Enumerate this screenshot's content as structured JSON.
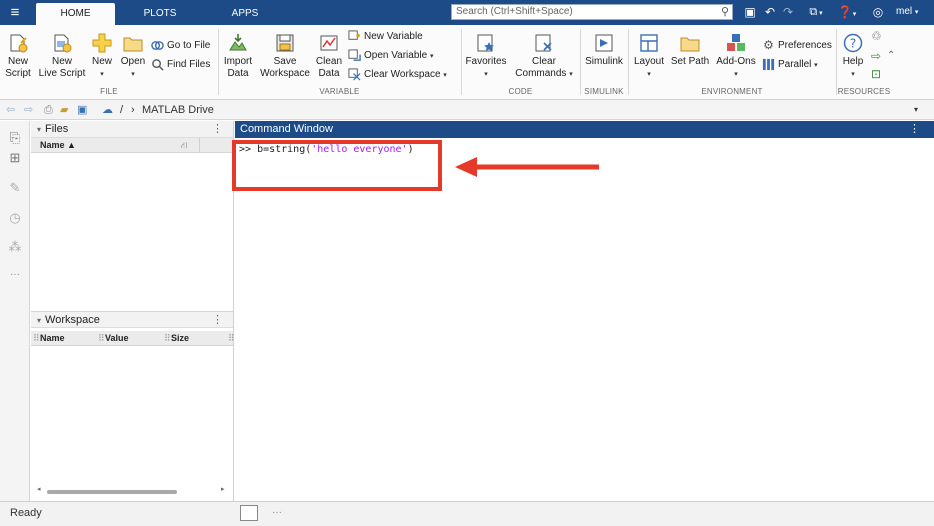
{
  "tabs": [
    {
      "label": "HOME",
      "active": true
    },
    {
      "label": "PLOTS",
      "active": false
    },
    {
      "label": "APPS",
      "active": false
    }
  ],
  "search": {
    "placeholder": "Search (Ctrl+Shift+Space)"
  },
  "user": {
    "name": "mel"
  },
  "ribbon": {
    "file": {
      "new_script": "New\nScript",
      "new_live_script": "New\nLive Script",
      "new": "New",
      "open": "Open",
      "go_to_file": "Go to File",
      "find_files": "Find Files",
      "group_label": "FILE"
    },
    "variable": {
      "import_data": "Import\nData",
      "save_workspace": "Save\nWorkspace",
      "clean_data": "Clean\nData",
      "new_variable": "New Variable",
      "open_variable": "Open Variable",
      "clear_workspace": "Clear Workspace",
      "group_label": "VARIABLE"
    },
    "code": {
      "favorites": "Favorites",
      "clear_commands": "Clear\nCommands",
      "group_label": "CODE"
    },
    "simulink": {
      "simulink": "Simulink",
      "group_label": "SIMULINK"
    },
    "environment": {
      "layout": "Layout",
      "set_path": "Set Path",
      "add_ons": "Add-Ons",
      "preferences": "Preferences",
      "parallel": "Parallel",
      "group_label": "ENVIRONMENT"
    },
    "resources": {
      "help": "Help",
      "group_label": "RESOURCES"
    }
  },
  "address": {
    "separator": "/",
    "path": "MATLAB Drive"
  },
  "files_panel": {
    "title": "Files",
    "col_name": "Name ▲"
  },
  "workspace_panel": {
    "title": "Workspace",
    "col_name": "Name",
    "col_value": "Value",
    "col_size": "Size"
  },
  "command_window": {
    "title": "Command Window",
    "prompt": ">> ",
    "code_prefix": "b=string(",
    "code_string": "'hello everyone'",
    "code_suffix": ")"
  },
  "status": {
    "text": "Ready"
  },
  "colors": {
    "titlebar": "#1d4b88",
    "highlight": "#e53a2a",
    "string": "#a020f0"
  }
}
